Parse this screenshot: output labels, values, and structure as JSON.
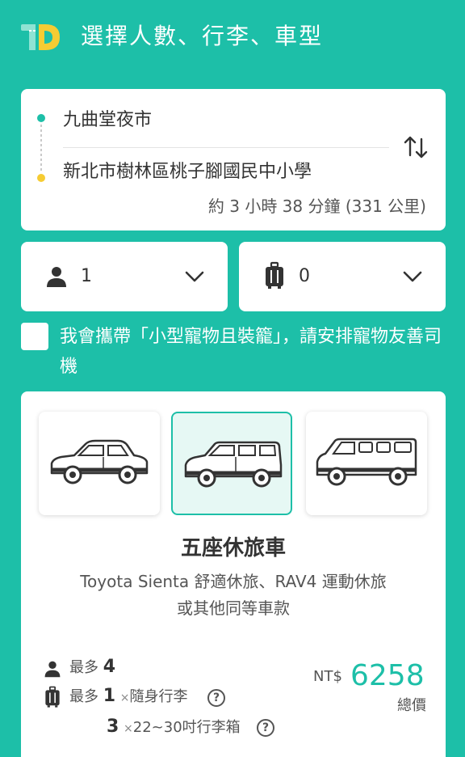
{
  "header": {
    "title": "選擇人數、行李、車型",
    "logo_text": "1D"
  },
  "route": {
    "origin": "九曲堂夜市",
    "destination": "新北市樹林區桃子腳國民中小學",
    "summary": "約 3 小時 38 分鐘 (331 公里)",
    "swap_icon": "swap-icon"
  },
  "selectors": {
    "passengers": {
      "value": "1",
      "icon": "person-icon"
    },
    "luggage": {
      "value": "0",
      "icon": "luggage-icon"
    }
  },
  "pet": {
    "checked": false,
    "label": "我會攜帶「小型寵物且裝籠」，請安排寵物友善司機"
  },
  "vehicles": {
    "options": [
      {
        "icon": "sedan-icon",
        "selected": false
      },
      {
        "icon": "suv-icon",
        "selected": true
      },
      {
        "icon": "van-icon",
        "selected": false
      }
    ],
    "selected_name": "五座休旅車",
    "selected_desc": "Toyota Sienta 舒適休旅、RAV4 運動休旅或其他同等車款"
  },
  "specs": {
    "max_prefix": "最多",
    "max_passengers": "4",
    "carry_on_count": "1",
    "times": "×",
    "carry_on_label": "隨身行李",
    "suitcase_count": "3",
    "suitcase_label": "22~30吋行李箱",
    "help": "?"
  },
  "price": {
    "currency": "NT$",
    "amount": "6258",
    "label": "總價"
  },
  "colors": {
    "brand": "#1dbfa8",
    "accent_yellow": "#f6cc33",
    "text": "#333333"
  }
}
